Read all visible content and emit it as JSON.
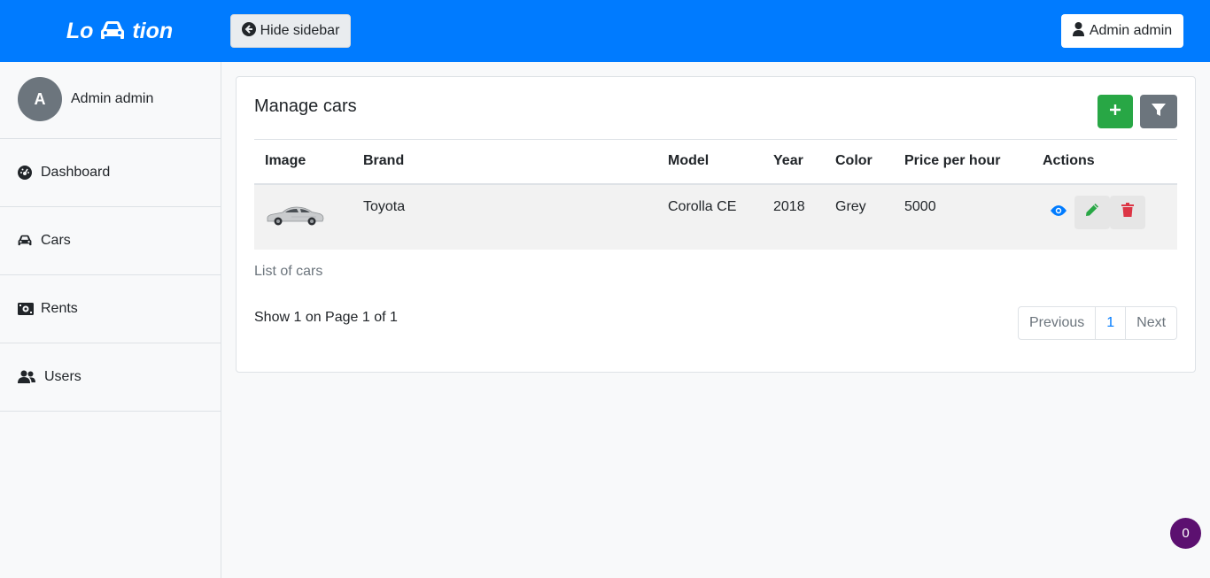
{
  "header": {
    "brand_left": "Lo",
    "brand_right": "tion",
    "brand_icon": "car-icon",
    "hide_sidebar_label": "Hide sidebar",
    "user_button_label": "Admin admin"
  },
  "sidebar": {
    "avatar_initial": "A",
    "user_name": "Admin admin",
    "items": [
      {
        "label": "Dashboard",
        "icon": "dashboard-icon"
      },
      {
        "label": "Cars",
        "icon": "car-icon"
      },
      {
        "label": "Rents",
        "icon": "money-icon"
      },
      {
        "label": "Users",
        "icon": "users-icon"
      }
    ]
  },
  "main": {
    "title": "Manage cars",
    "table": {
      "columns": [
        "Image",
        "Brand",
        "Model",
        "Year",
        "Color",
        "Price per hour",
        "Actions"
      ],
      "rows": [
        {
          "brand": "Toyota",
          "model": "Corolla CE",
          "year": "2018",
          "color": "Grey",
          "price": "5000"
        }
      ]
    },
    "caption": "List of cars",
    "page_info": "Show 1 on Page 1 of 1",
    "pagination": {
      "previous": "Previous",
      "current": "1",
      "next": "Next"
    }
  },
  "floating_badge": "0",
  "colors": {
    "primary": "#007bff",
    "success": "#28a745",
    "danger": "#dc3545",
    "secondary": "#6c757d",
    "badge": "#5c1070"
  }
}
